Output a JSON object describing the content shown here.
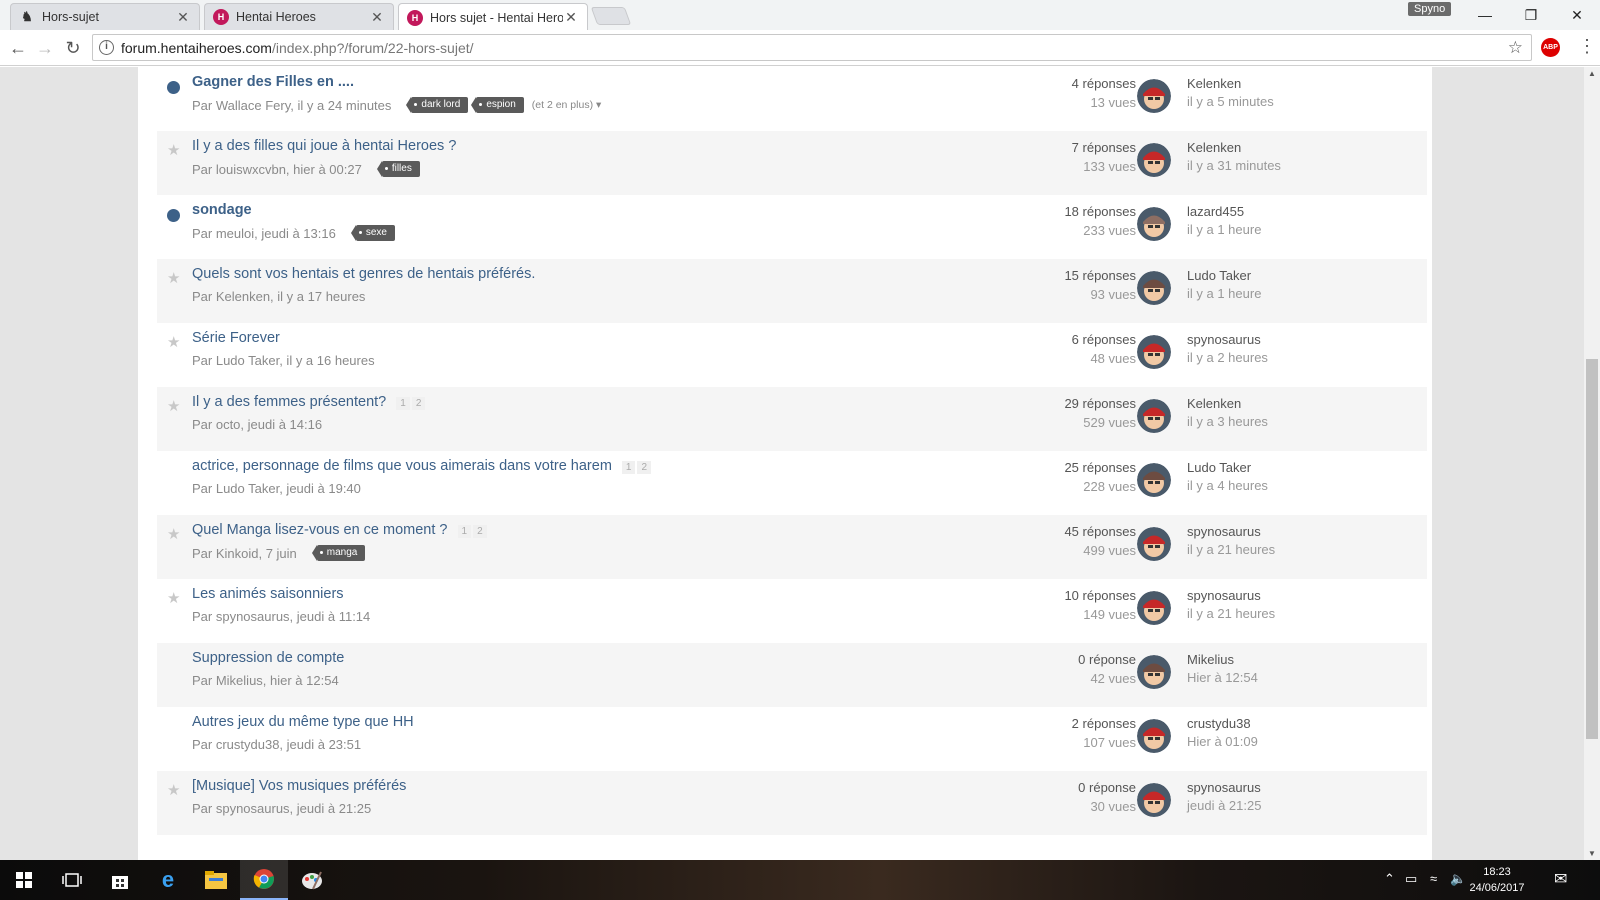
{
  "browser": {
    "tabs": [
      {
        "title": "Hors-sujet",
        "active": false
      },
      {
        "title": "Hentai Heroes",
        "active": false
      },
      {
        "title": "Hors sujet - Hentai Heroes",
        "active": true
      }
    ],
    "profile": "Spyno",
    "url_host": "forum.hentaiheroes.com",
    "url_path": "/index.php?/forum/22-hors-sujet/",
    "extension_label": "ABP"
  },
  "topics": [
    {
      "title": "Gagner des Filles en ....",
      "unread": true,
      "author_line": "Par Wallace Fery, il y a 24 minutes",
      "tags": [
        "dark lord",
        "espion"
      ],
      "more": "(et 2 en plus)",
      "pages": [],
      "replies": "4 réponses",
      "views": "13 vues",
      "last_user": "Kelenken",
      "last_time": "il y a 5 minutes",
      "avatar_color": "#c62828"
    },
    {
      "title": "Il y a des filles qui joue à hentai Heroes ?",
      "unread": false,
      "author_line": "Par louiswxcvbn, hier à 00:27",
      "tags": [
        "filles"
      ],
      "more": "",
      "pages": [],
      "replies": "7 réponses",
      "views": "133 vues",
      "last_user": "Kelenken",
      "last_time": "il y a 31 minutes",
      "avatar_color": "#c62828"
    },
    {
      "title": "sondage",
      "unread": true,
      "author_line": "Par meuloi, jeudi à 13:16",
      "tags": [
        "sexe"
      ],
      "more": "",
      "pages": [],
      "replies": "18 réponses",
      "views": "233 vues",
      "last_user": "lazard455",
      "last_time": "il y a 1 heure",
      "avatar_color": "#8d6e63"
    },
    {
      "title": "Quels sont vos hentais et genres de hentais préférés.",
      "unread": false,
      "author_line": "Par Kelenken, il y a 17 heures",
      "tags": [],
      "more": "",
      "pages": [],
      "replies": "15 réponses",
      "views": "93 vues",
      "last_user": "Ludo Taker",
      "last_time": "il y a 1 heure",
      "avatar_color": "#6d4c41"
    },
    {
      "title": "Série Forever",
      "unread": false,
      "author_line": "Par Ludo Taker, il y a 16 heures",
      "tags": [],
      "more": "",
      "pages": [],
      "replies": "6 réponses",
      "views": "48 vues",
      "last_user": "spynosaurus",
      "last_time": "il y a 2 heures",
      "avatar_color": "#c62828"
    },
    {
      "title": "Il y a des femmes présentent?",
      "unread": false,
      "author_line": "Par octo, jeudi à 14:16",
      "tags": [],
      "more": "",
      "pages": [
        "1",
        "2"
      ],
      "replies": "29 réponses",
      "views": "529 vues",
      "last_user": "Kelenken",
      "last_time": "il y a 3 heures",
      "avatar_color": "#c62828"
    },
    {
      "title": "actrice, personnage de films que vous aimerais dans votre harem",
      "unread": false,
      "nomarker": true,
      "author_line": "Par Ludo Taker, jeudi à 19:40",
      "tags": [],
      "more": "",
      "pages": [
        "1",
        "2"
      ],
      "replies": "25 réponses",
      "views": "228 vues",
      "last_user": "Ludo Taker",
      "last_time": "il y a 4 heures",
      "avatar_color": "#6d4c41"
    },
    {
      "title": "Quel Manga lisez-vous en ce moment ?",
      "unread": false,
      "author_line": "Par Kinkoid, 7 juin",
      "tags": [
        "manga"
      ],
      "more": "",
      "pages": [
        "1",
        "2"
      ],
      "replies": "45 réponses",
      "views": "499 vues",
      "last_user": "spynosaurus",
      "last_time": "il y a 21 heures",
      "avatar_color": "#c62828"
    },
    {
      "title": "Les animés saisonniers",
      "unread": false,
      "author_line": "Par spynosaurus, jeudi à 11:14",
      "tags": [],
      "more": "",
      "pages": [],
      "replies": "10 réponses",
      "views": "149 vues",
      "last_user": "spynosaurus",
      "last_time": "il y a 21 heures",
      "avatar_color": "#c62828"
    },
    {
      "title": "Suppression de compte",
      "unread": false,
      "nomarker": true,
      "author_line": "Par Mikelius, hier à 12:54",
      "tags": [],
      "more": "",
      "pages": [],
      "replies": "0 réponse",
      "views": "42 vues",
      "last_user": "Mikelius",
      "last_time": "Hier à 12:54",
      "avatar_color": "#6d4c41"
    },
    {
      "title": "Autres jeux du même type que HH",
      "unread": false,
      "nomarker": true,
      "author_line": "Par crustydu38, jeudi à 23:51",
      "tags": [],
      "more": "",
      "pages": [],
      "replies": "2 réponses",
      "views": "107 vues",
      "last_user": "crustydu38",
      "last_time": "Hier à 01:09",
      "avatar_color": "#c62828"
    },
    {
      "title": "[Musique] Vos musiques préférés",
      "unread": false,
      "author_line": "Par spynosaurus, jeudi à 21:25",
      "tags": [],
      "more": "",
      "pages": [],
      "replies": "0 réponse",
      "views": "30 vues",
      "last_user": "spynosaurus",
      "last_time": "jeudi à 21:25",
      "avatar_color": "#c62828"
    }
  ],
  "taskbar": {
    "time": "18:23",
    "date": "24/06/2017"
  }
}
